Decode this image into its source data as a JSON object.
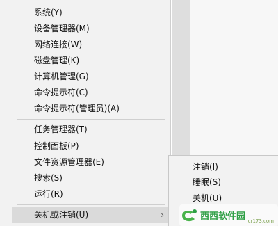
{
  "menu": {
    "items": [
      {
        "label": "系统(Y)"
      },
      {
        "label": "设备管理器(M)"
      },
      {
        "label": "网络连接(W)"
      },
      {
        "label": "磁盘管理(K)"
      },
      {
        "label": "计算机管理(G)"
      },
      {
        "label": "命令提示符(C)"
      },
      {
        "label": "命令提示符(管理员)(A)"
      },
      {
        "label": "任务管理器(T)"
      },
      {
        "label": "控制面板(P)"
      },
      {
        "label": "文件资源管理器(E)"
      },
      {
        "label": "搜索(S)"
      },
      {
        "label": "运行(R)"
      },
      {
        "label": "关机或注销(U)",
        "arrow": "›"
      }
    ]
  },
  "submenu": {
    "items": [
      {
        "label": "注销(I)"
      },
      {
        "label": "睡眠(S)"
      },
      {
        "label": "关机(U)"
      }
    ]
  },
  "watermark": {
    "text": "西西软件园",
    "subtext": "cr173.com"
  },
  "colors": {
    "menu_bg": "#f2f2f2",
    "selected_bg": "#dadada",
    "watermark_green": "#2e9f45"
  }
}
